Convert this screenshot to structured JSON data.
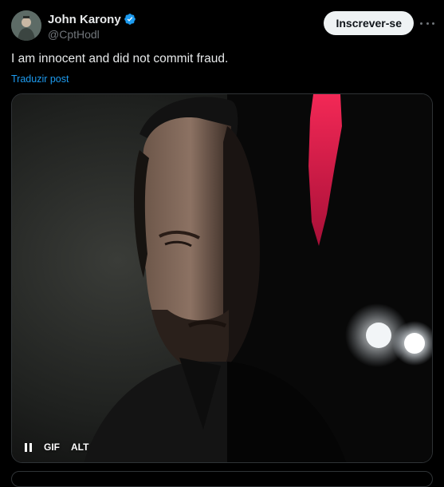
{
  "author": {
    "display_name": "John Karony",
    "handle": "@CptHodl",
    "verified": true,
    "verified_color": "#1d9bf0"
  },
  "header": {
    "subscribe_label": "Inscrever-se",
    "more_icon": "more-horizontal-icon"
  },
  "tweet": {
    "text": "I am innocent and did not commit fraud.",
    "translate_label": "Traduzir post"
  },
  "media": {
    "controls": {
      "pause_icon": "pause-icon",
      "gif_label": "GIF",
      "alt_label": "ALT"
    }
  },
  "colors": {
    "background": "#000000",
    "text": "#e7e9ea",
    "muted": "#71767b",
    "link": "#1d9bf0",
    "border": "#2f3336",
    "button_bg": "#eff3f4"
  }
}
